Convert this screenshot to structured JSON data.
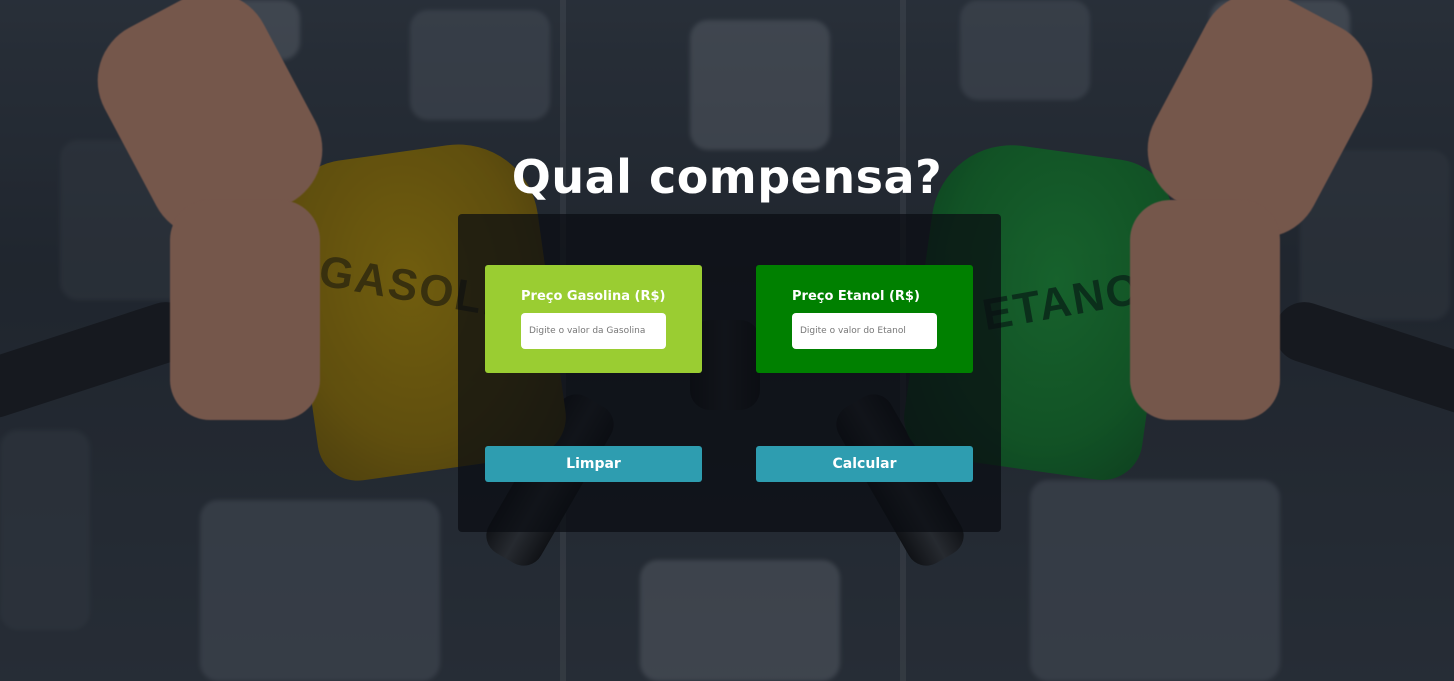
{
  "page": {
    "title": "Qual compensa?"
  },
  "background": {
    "nozzle_left_text": "GASOLINA",
    "nozzle_right_text": "ETANOL"
  },
  "gasoline": {
    "label": "Preço Gasolina (R$)",
    "placeholder": "Digite o valor da Gasolina",
    "value": "",
    "color": "#9acd32"
  },
  "ethanol": {
    "label": "Preço Etanol (R$)",
    "placeholder": "Digite o valor do Etanol",
    "value": "",
    "color": "#008000"
  },
  "actions": {
    "clear_label": "Limpar",
    "calculate_label": "Calcular",
    "button_color": "#2e9db0"
  }
}
